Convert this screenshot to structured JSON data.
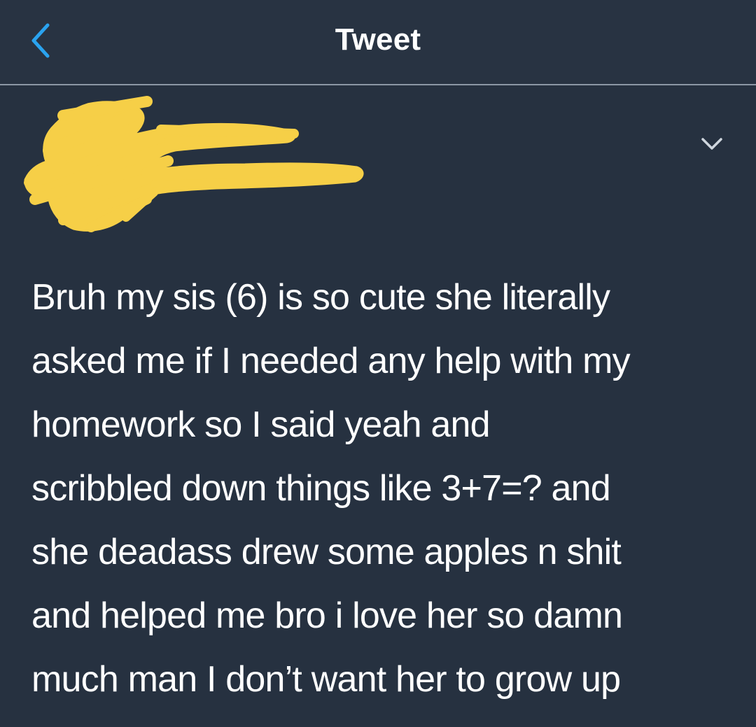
{
  "header": {
    "title": "Tweet",
    "back_icon": "chevron-left-icon",
    "accent_color": "#2aa3ef"
  },
  "author": {
    "redacted": true,
    "scribble_color": "#f6cf47"
  },
  "tweet": {
    "menu_icon": "chevron-down-icon",
    "text_lines": [
      "Bruh my sis (6) is so cute she literally",
      "asked me if I needed any help with my",
      "homework so I said yeah and",
      "scribbled down things like 3+7=? and",
      "she deadass drew some apples n shit",
      "and helped me bro i love her so damn",
      "much man I don’t want her to grow up"
    ]
  },
  "colors": {
    "background": "#263140",
    "divider": "#8c97a5",
    "text": "#ffffff"
  }
}
